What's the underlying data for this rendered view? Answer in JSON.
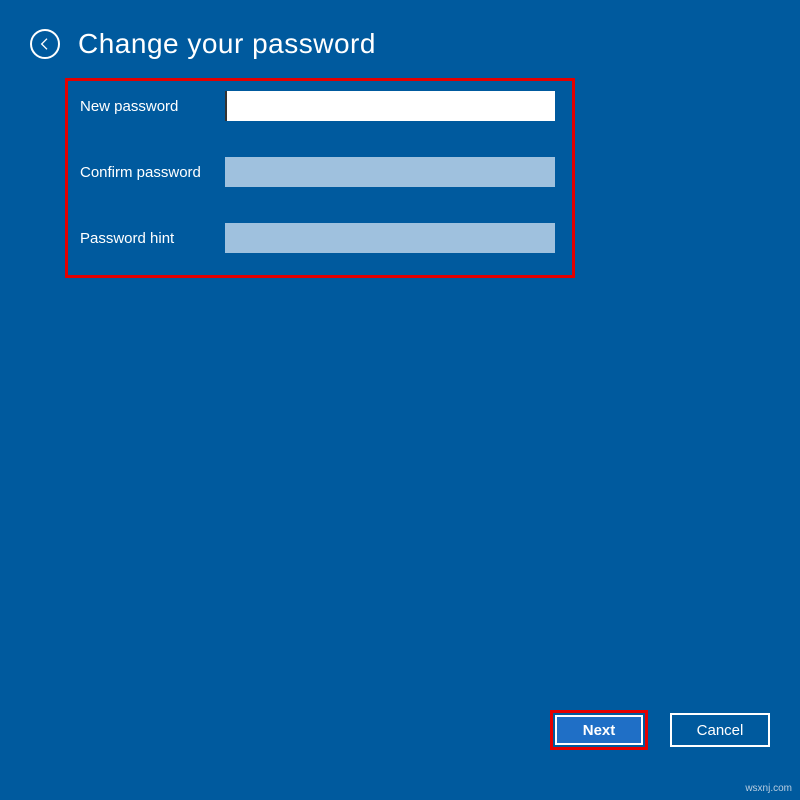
{
  "header": {
    "title": "Change your password"
  },
  "form": {
    "new_password_label": "New password",
    "new_password_value": "",
    "confirm_password_label": "Confirm password",
    "confirm_password_value": "",
    "password_hint_label": "Password hint",
    "password_hint_value": ""
  },
  "buttons": {
    "next_label": "Next",
    "cancel_label": "Cancel"
  },
  "watermark": "wsxnj.com",
  "colors": {
    "background": "#005a9e",
    "highlight": "#e40000",
    "input_dim": "#9fc1de",
    "primary_btn": "#1f6fc6"
  }
}
